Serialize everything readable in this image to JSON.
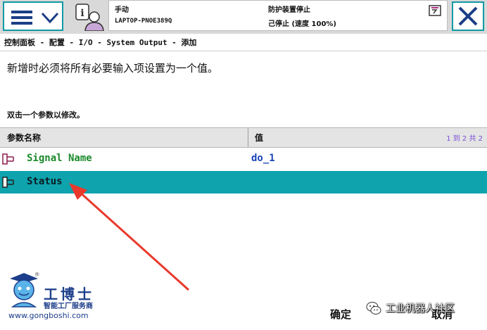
{
  "header": {
    "mode": "手动",
    "host": "LAPTOP-PNOE389Q",
    "guard_status": "防护装置停止",
    "run_state": "己停止 (速度 100%)"
  },
  "breadcrumb": "控制面板 - 配置 - I/O - System Output - 添加",
  "info_message": "新增时必须将所有必要输入项设置为一个值。",
  "hint": "双击一个参数以修改。",
  "table": {
    "col_name": "参数名称",
    "col_value": "值",
    "pager": "1 到 2 共 2",
    "rows": [
      {
        "name": "Signal Name",
        "value": "do_1"
      },
      {
        "name": "Status",
        "value": ""
      }
    ],
    "selected_row": 1
  },
  "buttons": {
    "ok": "确定",
    "cancel": "取消"
  },
  "watermark": {
    "brand": "工博士",
    "slogan": "智能工厂服务商",
    "url": "www.gongboshi.com",
    "reg": "®",
    "wechat": "工业机器人社区"
  },
  "colors": {
    "accent": "#0fa3ad",
    "param_name": "#1c8a2c",
    "param_value": "#1a44b8",
    "arrow": "#e8392c"
  },
  "icons": {
    "menu": "hamburger-menu-icon",
    "operator": "operator-info-icon",
    "close": "close-icon",
    "row": "parameter-icon"
  }
}
